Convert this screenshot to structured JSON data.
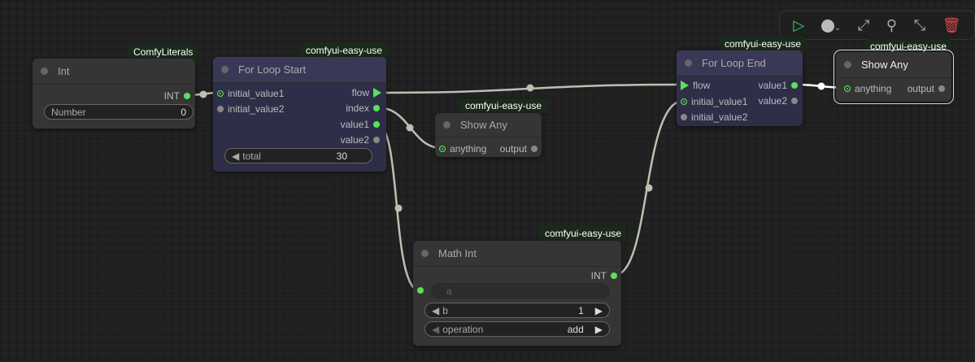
{
  "toolbar": {
    "run": "run-icon",
    "color": "color-icon",
    "bypass": "bypass-icon",
    "pin": "pin-icon",
    "collapse": "collapse-icon",
    "delete": "delete-icon"
  },
  "nodes": {
    "int": {
      "badge": "ComfyLiterals",
      "title": "Int",
      "output": "INT",
      "widget_label": "Number",
      "widget_value": "0"
    },
    "loop_start": {
      "badge": "comfyui-easy-use",
      "title": "For Loop Start",
      "inputs": [
        "initial_value1",
        "initial_value2"
      ],
      "outputs": [
        "flow",
        "index",
        "value1",
        "value2"
      ],
      "widget_label": "total",
      "widget_value": "30"
    },
    "show_any_1": {
      "badge": "comfyui-easy-use",
      "title": "Show Any",
      "input": "anything",
      "output": "output"
    },
    "loop_end": {
      "badge": "comfyui-easy-use",
      "title": "For Loop End",
      "inputs": [
        "flow",
        "initial_value1",
        "initial_value2"
      ],
      "outputs": [
        "value1",
        "value2"
      ]
    },
    "show_any_2": {
      "badge": "comfyui-easy-use",
      "title": "Show Any",
      "input": "anything",
      "output": "output"
    },
    "math_int": {
      "badge": "comfyui-easy-use",
      "title": "Math Int",
      "output": "INT",
      "input_a": "a",
      "b_label": "b",
      "b_value": "1",
      "op_label": "operation",
      "op_value": "add"
    }
  }
}
